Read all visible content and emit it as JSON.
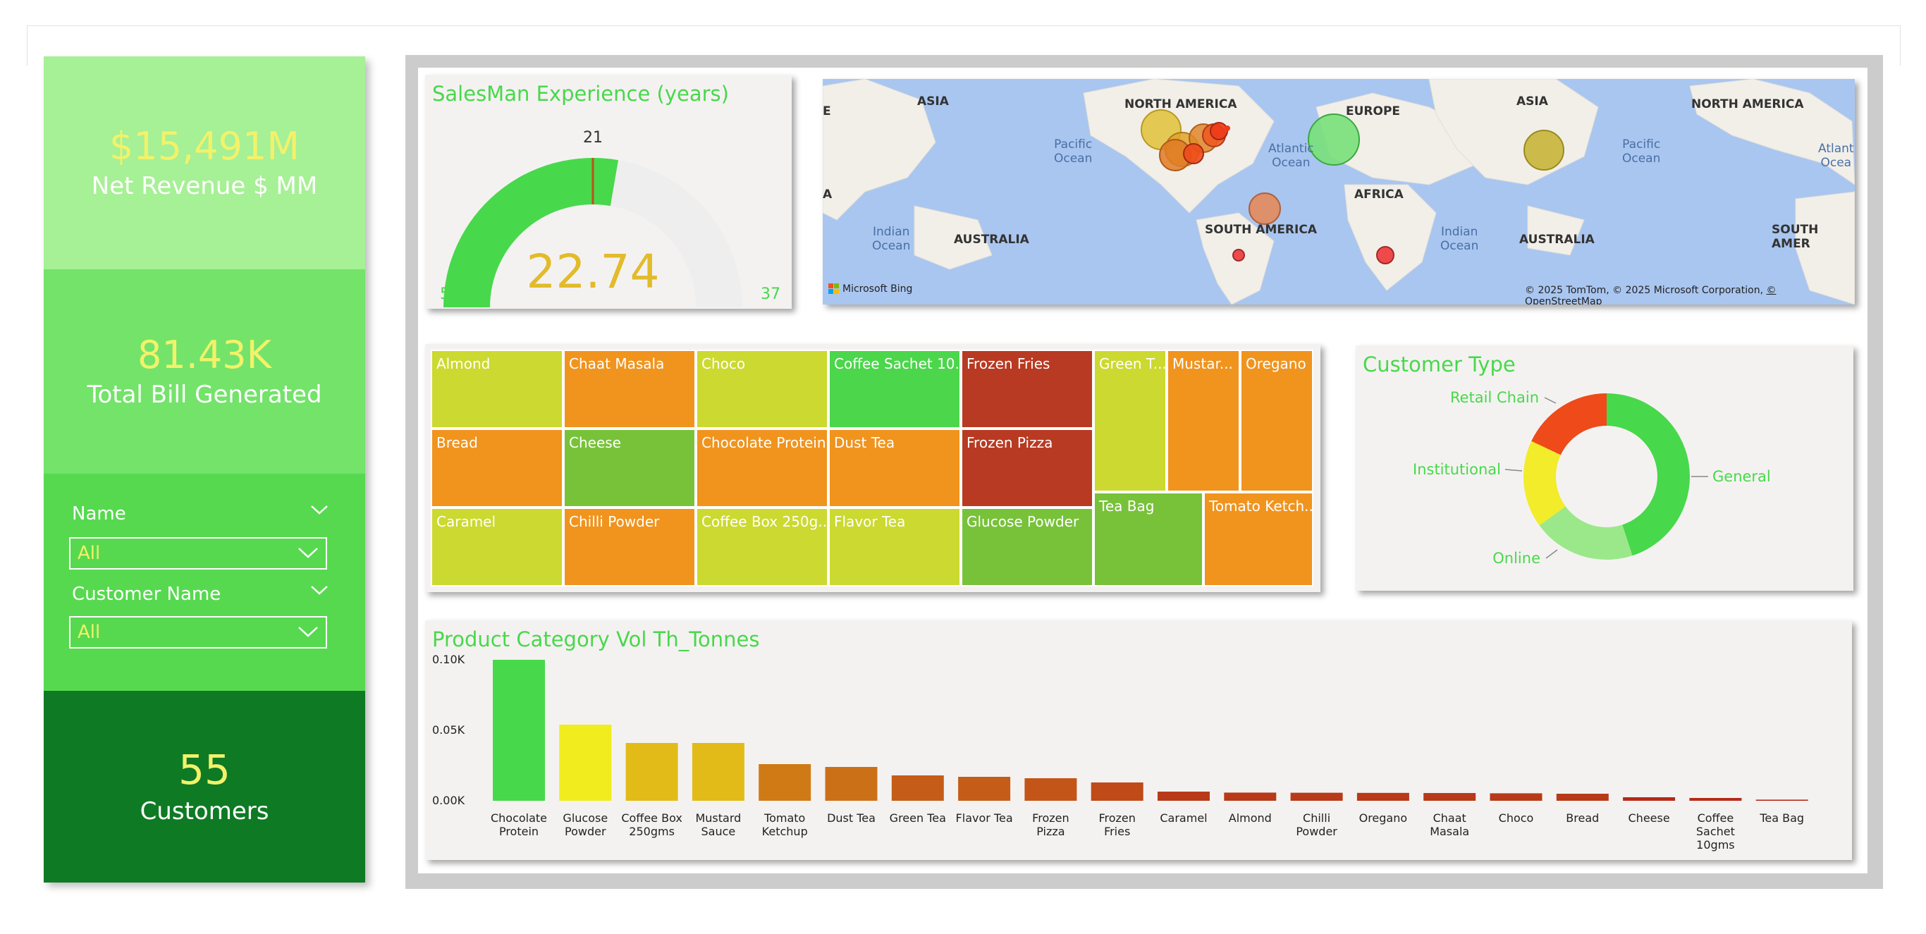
{
  "kpis": {
    "net_revenue": {
      "value": "$15,491M",
      "label": "Net Revenue $ MM"
    },
    "total_bill": {
      "value": "81.43K",
      "label": "Total Bill Generated"
    },
    "customers": {
      "value": "55",
      "label": "Customers"
    }
  },
  "filters": {
    "name": {
      "title": "Name",
      "value": "All"
    },
    "customer_name": {
      "title": "Customer Name",
      "value": "All"
    }
  },
  "gauge": {
    "title": "SalesMan Experience (years)",
    "min": "5",
    "max": "37",
    "target": "21",
    "value_label": "22.74",
    "min_num": 5,
    "max_num": 37,
    "target_num": 21,
    "value_num": 22.74
  },
  "map": {
    "continents": [
      "ASIA",
      "NORTH AMERICA",
      "EUROPE",
      "ASIA",
      "NORTH AMERICA",
      "AFRICA",
      "SOUTH AMERICA",
      "AUSTRALIA",
      "AUSTRALIA",
      "SOUTH AMER",
      "A",
      "E"
    ],
    "oceans": [
      "Pacific\nOcean",
      "Atlantic\nOcean",
      "Pacific\nOcean",
      "Indian\nOcean",
      "Indian\nOcean",
      "Atlant\nOcea"
    ],
    "brand": "Microsoft Bing",
    "copyright": "© 2025 TomTom, © 2025 Microsoft Corporation, ",
    "osm_link": "© OpenStreetMap"
  },
  "treemap": {
    "cells": [
      {
        "label": "Almond",
        "color": "#ccd930"
      },
      {
        "label": "Chaat Masala",
        "color": "#f0941e"
      },
      {
        "label": "Choco",
        "color": "#ccd930"
      },
      {
        "label": "Coffee Sachet 10...",
        "color": "#4bd64b"
      },
      {
        "label": "Frozen Fries",
        "color": "#b83a22"
      },
      {
        "label": "Green T...",
        "color": "#ccd930"
      },
      {
        "label": "Mustar...",
        "color": "#f0941e"
      },
      {
        "label": "Oregano",
        "color": "#f0941e"
      },
      {
        "label": "Bread",
        "color": "#f0941e"
      },
      {
        "label": "Cheese",
        "color": "#78c23a"
      },
      {
        "label": "Chocolate Protein",
        "color": "#f0941e"
      },
      {
        "label": "Dust Tea",
        "color": "#f0941e"
      },
      {
        "label": "Frozen Pizza",
        "color": "#b83a22"
      },
      {
        "label": "Tea Bag",
        "color": "#78c23a"
      },
      {
        "label": "Tomato Ketch...",
        "color": "#f0941e"
      },
      {
        "label": "Caramel",
        "color": "#ccd930"
      },
      {
        "label": "Chilli Powder",
        "color": "#f0941e"
      },
      {
        "label": "Coffee Box 250g...",
        "color": "#ccd930"
      },
      {
        "label": "Flavor Tea",
        "color": "#ccd930"
      },
      {
        "label": "Glucose Powder",
        "color": "#78c23a"
      }
    ]
  },
  "donut": {
    "title": "Customer Type",
    "slices": [
      {
        "label": "General",
        "value": 45,
        "color": "#48d84b"
      },
      {
        "label": "Online",
        "value": 20,
        "color": "#9be88a"
      },
      {
        "label": "Institutional",
        "value": 17,
        "color": "#f2ec2a"
      },
      {
        "label": "Retail Chain",
        "value": 18,
        "color": "#ee4a1a"
      }
    ]
  },
  "bar": {
    "title": "Product Category Vol Th_Tonnes"
  },
  "chart_data": {
    "type": "bar",
    "title": "Product Category Vol Th_Tonnes",
    "categories": [
      "Chocolate Protein",
      "Glucose Powder",
      "Coffee Box 250gms",
      "Mustard Sauce",
      "Tomato Ketchup",
      "Dust Tea",
      "Green Tea",
      "Flavor Tea",
      "Frozen Pizza",
      "Frozen Fries",
      "Caramel",
      "Almond",
      "Chilli Powder",
      "Oregano",
      "Chaat Masala",
      "Choco",
      "Bread",
      "Cheese",
      "Coffee Sachet 10gms",
      "Tea Bag"
    ],
    "category_lines": [
      [
        "Chocolate",
        "Protein"
      ],
      [
        "Glucose",
        "Powder"
      ],
      [
        "Coffee Box",
        "250gms"
      ],
      [
        "Mustard",
        "Sauce"
      ],
      [
        "Tomato",
        "Ketchup"
      ],
      [
        "Dust Tea"
      ],
      [
        "Green Tea"
      ],
      [
        "Flavor Tea"
      ],
      [
        "Frozen",
        "Pizza"
      ],
      [
        "Frozen",
        "Fries"
      ],
      [
        "Caramel"
      ],
      [
        "Almond"
      ],
      [
        "Chilli",
        "Powder"
      ],
      [
        "Oregano"
      ],
      [
        "Chaat",
        "Masala"
      ],
      [
        "Choco"
      ],
      [
        "Bread"
      ],
      [
        "Cheese"
      ],
      [
        "Coffee",
        "Sachet",
        "10gms"
      ],
      [
        "Tea Bag"
      ]
    ],
    "values": [
      0.1,
      0.054,
      0.041,
      0.041,
      0.026,
      0.024,
      0.018,
      0.017,
      0.016,
      0.013,
      0.0065,
      0.0058,
      0.0057,
      0.0056,
      0.0055,
      0.0053,
      0.005,
      0.0025,
      0.002,
      0.0008
    ],
    "colors": [
      "#48d84b",
      "#f0ec1e",
      "#e2bb18",
      "#e2bb18",
      "#d07a16",
      "#cc7018",
      "#c55d18",
      "#c55d18",
      "#c45518",
      "#c04a18",
      "#b83a18",
      "#b83a18",
      "#b83a18",
      "#b83a18",
      "#b83a18",
      "#b83a18",
      "#b83a18",
      "#b42a18",
      "#b42a18",
      "#b42a18"
    ],
    "yticks": [
      "0.00K",
      "0.05K",
      "0.10K"
    ],
    "ylim": [
      0,
      0.1
    ]
  }
}
